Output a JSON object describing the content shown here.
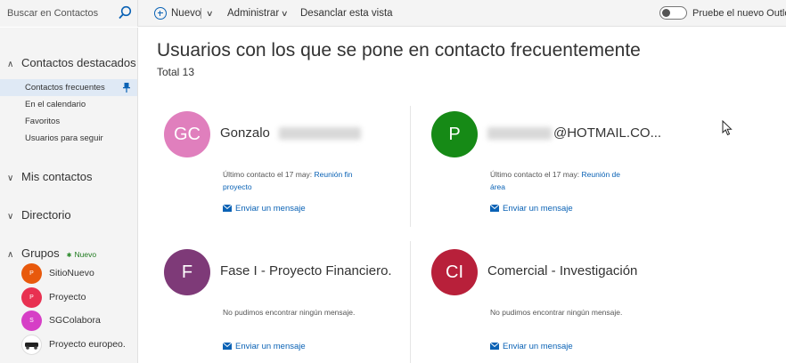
{
  "search": {
    "placeholder": "Buscar en Contactos",
    "icon": "search-icon"
  },
  "toolbar": {
    "new_label": "Nuevo",
    "admin_label": "Administrar",
    "unpin_label": "Desanclar esta vista",
    "toggle_label": "Pruebe el nuevo Outlo"
  },
  "sidebar": {
    "featured_title": "Contactos destacados",
    "featured_items": [
      {
        "label": "Contactos frecuentes",
        "selected": true
      },
      {
        "label": "En el calendario"
      },
      {
        "label": "Favoritos"
      },
      {
        "label": "Usuarios para seguir"
      }
    ],
    "my_contacts": "Mis contactos",
    "directory": "Directorio",
    "groups_title": "Grupos",
    "groups_new_badge": "Nuevo",
    "groups": [
      {
        "initials": "P",
        "name": "SitioNuevo",
        "color": "#e8590c"
      },
      {
        "initials": "P",
        "name": "Proyecto",
        "color": "#e83151"
      },
      {
        "initials": "S",
        "name": "SGColabora",
        "color": "#d63fc6"
      },
      {
        "initials": "",
        "name": "Proyecto europeo.",
        "color": "#ffffff"
      }
    ]
  },
  "main": {
    "title": "Usuarios con los que se pone en contacto frecuentemente",
    "total": "Total 13",
    "cards": [
      {
        "initials": "GC",
        "name": "Gonzalo",
        "color": "#e07fbd",
        "meta_prefix": "Último contacto el 17 may:",
        "meta_link": "Reunión fin proyecto",
        "send": "Enviar un mensaje"
      },
      {
        "initials": "P",
        "name": "@HOTMAIL.CO...",
        "color": "#168a16",
        "meta_prefix": "Último contacto el 17 may:",
        "meta_link": "Reunión de área",
        "send": "Enviar un mensaje"
      },
      {
        "initials": "F",
        "name": "Fase I - Proyecto Financiero.",
        "color": "#7e3a78",
        "meta_prefix": "No pudimos encontrar ningún mensaje.",
        "meta_link": "",
        "send": "Enviar un mensaje"
      },
      {
        "initials": "CI",
        "name": "Comercial - Investigación",
        "color": "#b8203a",
        "meta_prefix": "No pudimos encontrar ningún mensaje.",
        "meta_link": "",
        "send": "Enviar un mensaje"
      }
    ]
  },
  "colors": {
    "accent": "#0a62b5",
    "sidebar_bg": "#f4f4f4",
    "selected_bg": "#dfe9f5"
  }
}
